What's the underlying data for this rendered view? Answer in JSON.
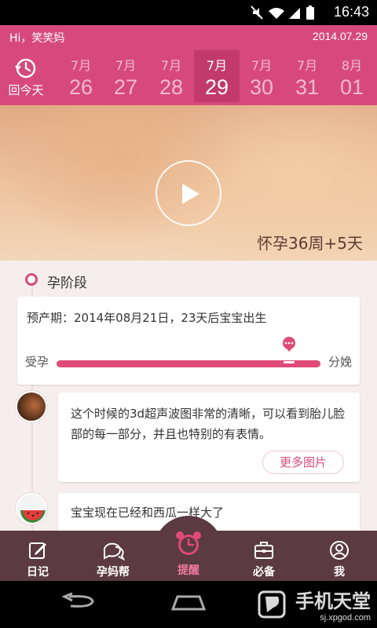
{
  "status_bar": {
    "time": "16:43"
  },
  "header": {
    "greeting": "Hi，笑笑妈",
    "date": "2014.07.29",
    "today_label": "回今天",
    "days": [
      {
        "month": "7月",
        "day": "26"
      },
      {
        "month": "7月",
        "day": "27"
      },
      {
        "month": "7月",
        "day": "28"
      },
      {
        "month": "7月",
        "day": "29"
      },
      {
        "month": "7月",
        "day": "30"
      },
      {
        "month": "7月",
        "day": "31"
      },
      {
        "month": "8月",
        "day": "01"
      }
    ]
  },
  "hero": {
    "pregnancy_text": "怀孕36周+5天"
  },
  "stage": {
    "title": "孕阶段",
    "due_date_text": "预产期：2014年08月21日，23天后宝宝出生",
    "start_label": "受孕",
    "end_label": "分娩",
    "progress_fraction": 0.88
  },
  "feed": [
    {
      "text": "这个时候的3d超声波图非常的清晰，可以看到胎儿脸部的每一部分，并且也特别的有表情。",
      "button": "更多图片"
    },
    {
      "text": "宝宝现在已经和西瓜一样大了"
    }
  ],
  "nav": [
    {
      "label": "日记",
      "icon": "edit-icon"
    },
    {
      "label": "孕妈帮",
      "icon": "chat-bubbles-icon"
    },
    {
      "label": "提醒",
      "icon": "alarm-clock-icon"
    },
    {
      "label": "必备",
      "icon": "bag-icon"
    },
    {
      "label": "我",
      "icon": "person-icon"
    }
  ],
  "watermark": {
    "title": "手机天堂",
    "url": "sj.xpgod.com"
  },
  "colors": {
    "accent": "#d7497c",
    "nav_bg": "#5b3a41",
    "active_nav": "#f07aa2"
  }
}
